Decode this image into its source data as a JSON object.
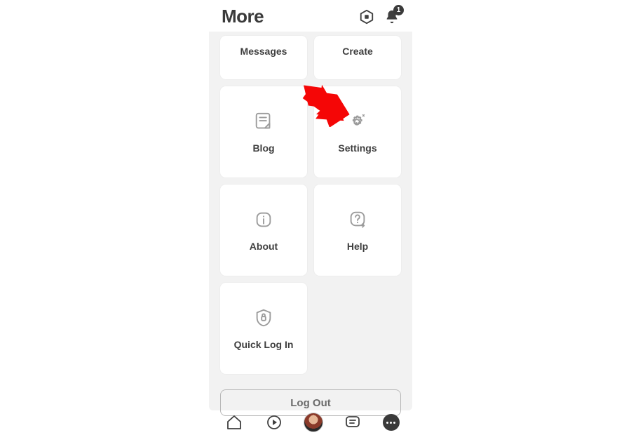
{
  "header": {
    "title": "More",
    "notification_count": "1"
  },
  "tiles": {
    "messages": "Messages",
    "create": "Create",
    "blog": "Blog",
    "settings": "Settings",
    "about": "About",
    "help": "Help",
    "quick_log_in": "Quick Log In"
  },
  "actions": {
    "log_out": "Log Out"
  }
}
